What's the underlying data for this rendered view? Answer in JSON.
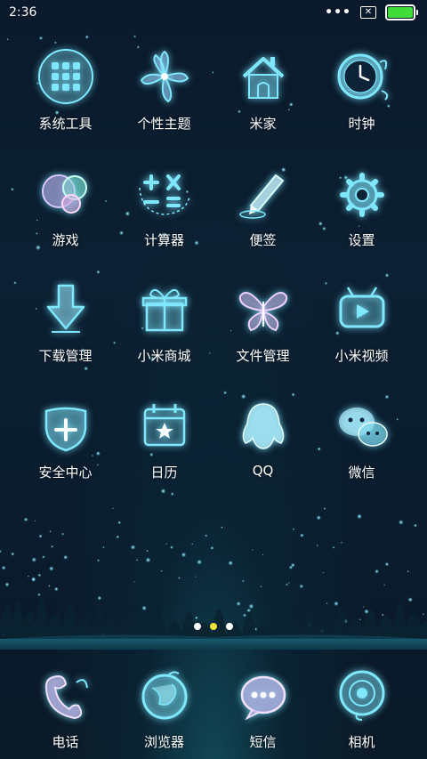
{
  "status_bar": {
    "time": "2:36",
    "more_dots": "•••",
    "battery_level": 1.0,
    "battery_color": "#3fdc3a"
  },
  "home": {
    "apps": [
      {
        "label": "系统工具",
        "icon": "system-tools-folder-icon"
      },
      {
        "label": "个性主题",
        "icon": "themes-flower-icon"
      },
      {
        "label": "米家",
        "icon": "mijia-house-icon"
      },
      {
        "label": "时钟",
        "icon": "clock-icon"
      },
      {
        "label": "游戏",
        "icon": "games-bubbles-icon"
      },
      {
        "label": "计算器",
        "icon": "calculator-icon"
      },
      {
        "label": "便签",
        "icon": "notes-pen-icon"
      },
      {
        "label": "设置",
        "icon": "settings-gear-icon"
      },
      {
        "label": "下载管理",
        "icon": "download-arrow-icon"
      },
      {
        "label": "小米商城",
        "icon": "mi-store-gift-icon"
      },
      {
        "label": "文件管理",
        "icon": "file-manager-butterfly-icon"
      },
      {
        "label": "小米视频",
        "icon": "mi-video-tv-icon"
      },
      {
        "label": "安全中心",
        "icon": "security-shield-icon"
      },
      {
        "label": "日历",
        "icon": "calendar-icon"
      },
      {
        "label": "QQ",
        "icon": "qq-penguin-icon"
      },
      {
        "label": "微信",
        "icon": "wechat-bubbles-icon"
      }
    ],
    "pages": 3,
    "current_page": 2
  },
  "dock": {
    "apps": [
      {
        "label": "电话",
        "icon": "phone-icon"
      },
      {
        "label": "浏览器",
        "icon": "browser-globe-icon"
      },
      {
        "label": "短信",
        "icon": "messages-bubble-icon"
      },
      {
        "label": "相机",
        "icon": "camera-lens-icon"
      }
    ]
  },
  "colors": {
    "glow": "#7fe8ff",
    "indicator_active": "#f5e23a"
  }
}
